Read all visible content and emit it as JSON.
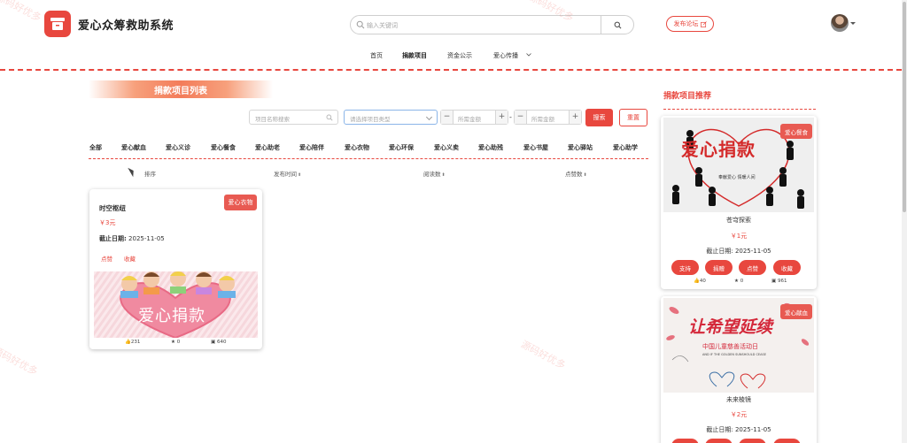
{
  "header": {
    "app_title": "爱心众筹救助系统",
    "search_placeholder": "输入关键词",
    "post_forum_label": "发布论坛"
  },
  "nav": {
    "items": [
      "首页",
      "捐款项目",
      "资金公示",
      "爱心传播"
    ],
    "active": "捐款项目"
  },
  "list": {
    "title": "捐款项目列表",
    "name_placeholder": "项目名称搜索",
    "type_placeholder": "请选择项目类型",
    "amount_min_placeholder": "所需金额",
    "amount_max_placeholder": "所需金额",
    "range_separator": "-",
    "search_label": "搜索",
    "reset_label": "重置",
    "categories": [
      "全部",
      "爱心献血",
      "爱心义诊",
      "爱心餐食",
      "爱心助老",
      "爱心陪伴",
      "爱心衣物",
      "爱心环保",
      "爱心义卖",
      "爱心助残",
      "爱心书屋",
      "爱心驿站",
      "爱心助学"
    ],
    "sort_labels": [
      "排序",
      "发布时间",
      "阅读数",
      "点赞数"
    ]
  },
  "project_card": {
    "badge": "爱心衣物",
    "title": "时空枢纽",
    "price": "￥3元",
    "date_label": "截止日期:",
    "date_value": "2025-11-05",
    "like_label": "点赞",
    "favorite_label": "收藏",
    "image_text": "爱心捐款",
    "likes": "231",
    "stars": "0",
    "reads": "640"
  },
  "recommend": {
    "title": "捐款项目推荐",
    "items": [
      {
        "badge": "爱心餐食",
        "image_text": "爱心捐款",
        "image_subtext": "奉献爱心 情暖人间",
        "name": "苍穹探索",
        "price": "￥1元",
        "date": "截止日期: 2025-11-05",
        "buttons": [
          "支持",
          "捐赠",
          "点赞",
          "收藏"
        ],
        "likes": "40",
        "stars": "0",
        "reads": "961"
      },
      {
        "badge": "爱心献血",
        "image_text": "让希望延续",
        "image_subtext": "中国儿童慈善活动日",
        "image_subtext2": "AND IF THE GOLDEN SUNSHOULD CEASE",
        "name": "未来棱镜",
        "price": "￥2元",
        "date": "截止日期: 2025-11-05"
      }
    ]
  },
  "watermark_text": "源码好优多",
  "colors": {
    "accent": "#e8473e",
    "badge": "#e85a52"
  },
  "icons": [
    "app-logo-icon",
    "search-icon",
    "external-link-icon",
    "chevron-down-icon",
    "thumb-up-icon",
    "star-icon",
    "read-icon"
  ]
}
